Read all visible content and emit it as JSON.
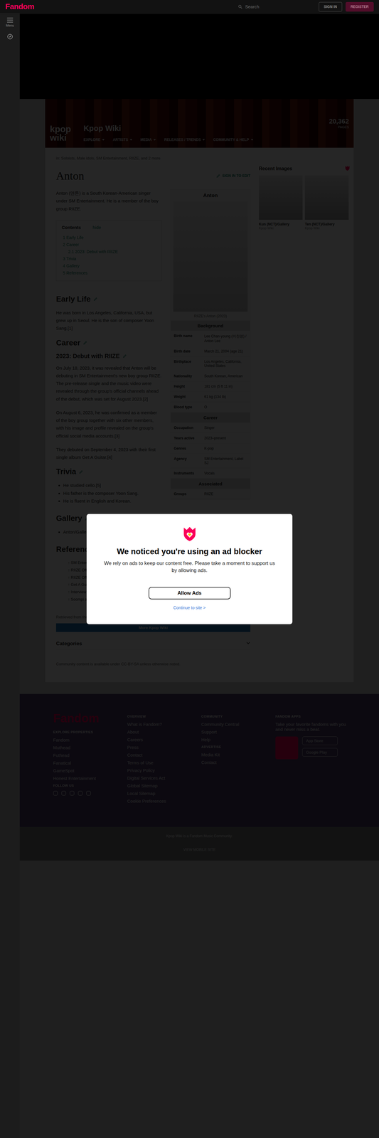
{
  "topbar": {
    "logo": "Fandom",
    "search": "Search",
    "sign_in": "SIGN IN",
    "register": "REGISTER"
  },
  "rail": {
    "menu": "Menu"
  },
  "wiki": {
    "logo_top": "kpop",
    "logo_bottom": "wiki",
    "name": "Kpop Wiki",
    "nav": [
      "EXPLORE",
      "ARTISTS",
      "MEDIA",
      "RELEASES / TRENDS",
      "COMMUNITY & HELP"
    ],
    "count": "20,362",
    "count_label": "PAGES"
  },
  "article": {
    "categories_line": "in: Soloists, Male idols, SM Entertainment, RIIZE, and 2 more",
    "title": "Anton",
    "edit": "SIGN IN TO EDIT",
    "intro": "Anton (앤톤) is a South Korean-American singer under SM Entertainment. He is a member of the boy group RIIZE.",
    "toc": {
      "title": "Contents",
      "toggle": "hide",
      "items": [
        {
          "number": "1",
          "label": "Early Life",
          "kind": "section"
        },
        {
          "number": "2",
          "label": "Career",
          "kind": "section"
        },
        {
          "number": "2.1",
          "label": "2023: Debut with RIIZE",
          "kind": "subsection"
        },
        {
          "number": "3",
          "label": "Trivia",
          "kind": "section"
        },
        {
          "number": "4",
          "label": "Gallery",
          "kind": "section"
        },
        {
          "number": "5",
          "label": "References",
          "kind": "section"
        }
      ]
    },
    "early_life": {
      "heading": "Early Life",
      "text": "He was born in Los Angeles, California, USA, but grew up in Seoul. He is the son of composer Yoon Sang.[1]"
    },
    "career": {
      "heading": "Career",
      "subheading": "2023: Debut with RIIZE",
      "paragraphs": [
        "On July 18, 2023, it was revealed that Anton will be debuting in SM Entertainment's new boy group RIIZE. The pre-release single and the music video were revealed through the group's official channels ahead of the debut, which was set for August 2023.[2]",
        "On August 6, 2023, he was confirmed as a member of the boy group together with six other members, with his image and profile revealed on the group's official social media accounts.[3]",
        "They debuted on September 4, 2023 with their first single album Get A Guitar.[4]"
      ]
    },
    "trivia": {
      "heading": "Trivia",
      "items": [
        "He studied cello.[5]",
        "His father is the composer Yoon Sang.",
        "He is fluent in English and Korean."
      ]
    },
    "gallery": {
      "heading": "Gallery",
      "link": "Anton/Gallery"
    },
    "references": {
      "heading": "References",
      "items": [
        "↑ SM Entertainment Official Profile",
        "↑ RIIZE Official Twitter announcement",
        "↑ RIIZE Official Instagram profile",
        "↑ Get A Guitar release article",
        "↑ Interview with Anton",
        "↑ Soompi article"
      ]
    },
    "license_note": "Retrieved from the Kpop Wiki",
    "more_bar": "More Kpop Wiki",
    "categories": "Categories",
    "community": "Community content is available under CC-BY-SA unless otherwise noted."
  },
  "infobox": {
    "title": "Anton",
    "caption": "RIIZE's Anton (2023)",
    "groups": [
      {
        "heading": "Background",
        "rows": [
          {
            "label": "Birth name",
            "value": "Lee Chan-young (이찬영) / Anton Lee"
          },
          {
            "label": "Birth date",
            "value": "March 21, 2004 (age 21)"
          },
          {
            "label": "Birthplace",
            "value": "Los Angeles, California, United States"
          },
          {
            "label": "Nationality",
            "value": "South Korean, American"
          },
          {
            "label": "Height",
            "value": "181 cm (5 ft 11 in)"
          },
          {
            "label": "Weight",
            "value": "61 kg (134 lb)"
          },
          {
            "label": "Blood type",
            "value": "O"
          }
        ]
      },
      {
        "heading": "Career",
        "rows": [
          {
            "label": "Occupation",
            "value": "Singer"
          },
          {
            "label": "Years active",
            "value": "2023–present"
          },
          {
            "label": "Genres",
            "value": "K-pop"
          },
          {
            "label": "Agency",
            "value": "SM Entertainment, Label SJ"
          },
          {
            "label": "Instruments",
            "value": "Vocals"
          }
        ]
      },
      {
        "heading": "Associated",
        "rows": [
          {
            "label": "Groups",
            "value": "RIIZE"
          }
        ]
      }
    ]
  },
  "recent_images": {
    "title": "Recent Images",
    "items": [
      {
        "caption": "Kun (NCT)/Gallery",
        "meta": "Kpop Wiki"
      },
      {
        "caption": "Ten (NCT)/Gallery",
        "meta": "Kpop Wiki"
      }
    ]
  },
  "footer": {
    "logo": "Fandom",
    "columns": [
      {
        "title": "EXPLORE PROPERTIES",
        "links": [
          "Fandom",
          "Muthead",
          "Futhead",
          "Fanatical",
          "GameSpot",
          "Honest Entertainment"
        ]
      },
      {
        "title": "OVERVIEW",
        "links": [
          "What is Fandom?",
          "About",
          "Careers",
          "Press",
          "Contact",
          "Terms of Use",
          "Privacy Policy",
          "Digital Services Act",
          "Global Sitemap",
          "Local Sitemap",
          "Cookie Preferences"
        ]
      },
      {
        "title": "COMMUNITY",
        "links": [
          "Community Central",
          "Support",
          "Help"
        ]
      }
    ],
    "advertise": {
      "title": "ADVERTISE",
      "links": [
        "Media Kit",
        "Contact"
      ]
    },
    "follow": "FOLLOW US",
    "apps": {
      "title": "FANDOM APPS",
      "text": "Take your favorite fandoms with you and never miss a beat.",
      "stores": [
        "App Store",
        "Google Play"
      ]
    },
    "community_line": "Kpop Wiki is a Fandom Music Community.",
    "mobile": "VIEW MOBILE SITE"
  },
  "modal": {
    "title": "We noticed you're using an ad blocker",
    "text": "We rely on ads to keep our content free. Please take a moment to support us by allowing ads.",
    "button": "Allow Ads",
    "link": "Continue to site >"
  }
}
